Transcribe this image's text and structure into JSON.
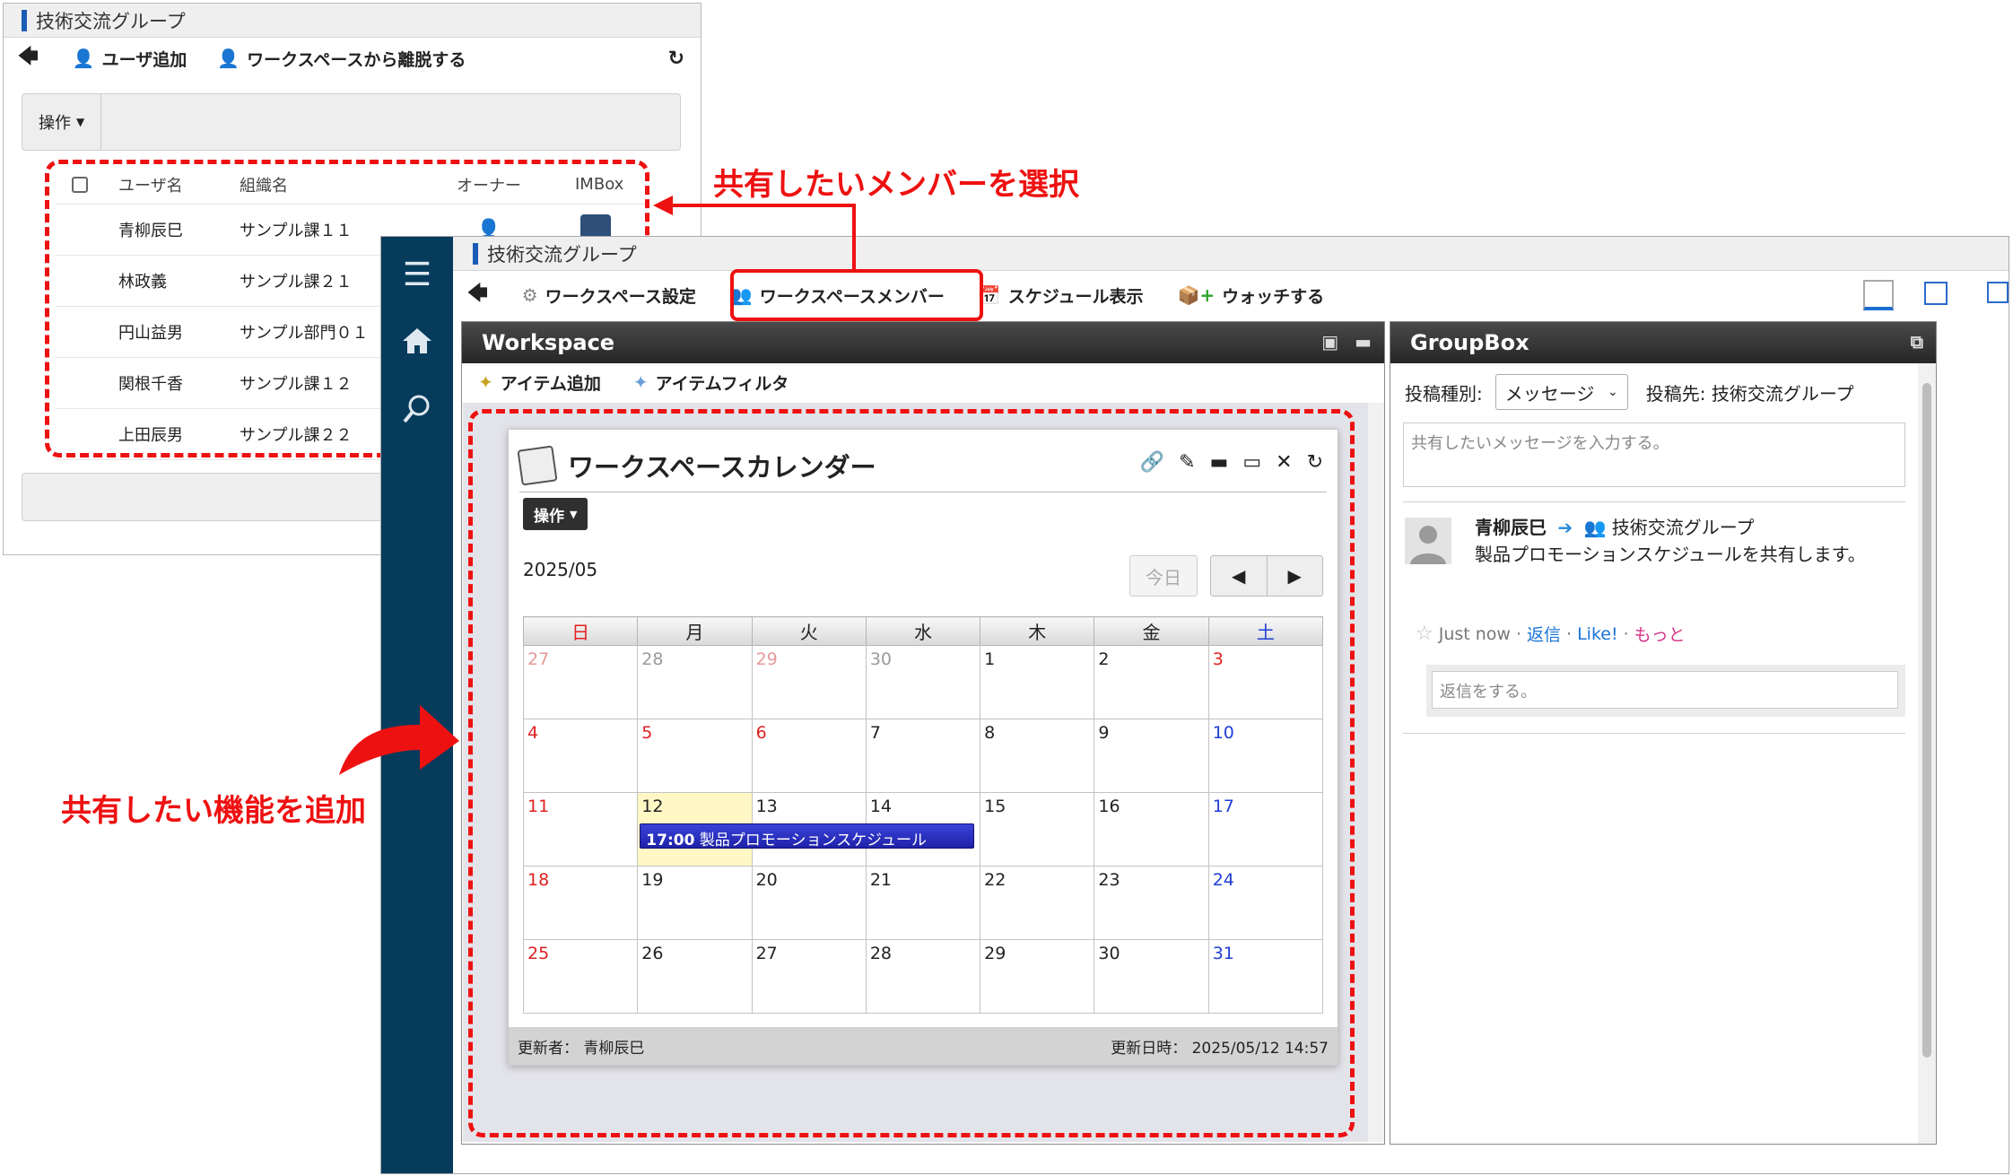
{
  "back_window": {
    "title": "技術交流グループ",
    "toolbar": {
      "add_user": "ユーザ追加",
      "leave": "ワークスペースから離脱する"
    },
    "ops_label": "操作",
    "table": {
      "headers": [
        "ユーザ名",
        "組織名",
        "オーナー",
        "IMBox"
      ],
      "rows": [
        {
          "user": "青柳辰巳",
          "org": "サンプル課１１"
        },
        {
          "user": "林政義",
          "org": "サンプル課２１"
        },
        {
          "user": "円山益男",
          "org": "サンプル部門０１"
        },
        {
          "user": "関根千香",
          "org": "サンプル課１２"
        },
        {
          "user": "上田辰男",
          "org": "サンプル課２２"
        }
      ]
    }
  },
  "front_window": {
    "title": "技術交流グループ",
    "toolbar": {
      "settings": "ワークスペース設定",
      "members": "ワークスペースメンバー",
      "schedule": "スケジュール表示",
      "watch": "ウォッチする"
    },
    "workspace": {
      "title": "Workspace",
      "add_item": "アイテム追加",
      "item_filter": "アイテムフィルタ"
    },
    "calendar": {
      "title": "ワークスペースカレンダー",
      "ops_label": "操作",
      "month": "2025/05",
      "today_label": "今日",
      "weekdays": [
        "日",
        "月",
        "火",
        "水",
        "木",
        "金",
        "土"
      ],
      "weeks": [
        [
          "27",
          "28",
          "29",
          "30",
          "1",
          "2",
          "3"
        ],
        [
          "4",
          "5",
          "6",
          "7",
          "8",
          "9",
          "10"
        ],
        [
          "11",
          "12",
          "13",
          "14",
          "15",
          "16",
          "17"
        ],
        [
          "18",
          "19",
          "20",
          "21",
          "22",
          "23",
          "24"
        ],
        [
          "25",
          "26",
          "27",
          "28",
          "29",
          "30",
          "31"
        ]
      ],
      "event": {
        "time": "17:00",
        "title": "製品プロモーションスケジュール"
      },
      "footer": {
        "updater_label": "更新者：",
        "updater": "青柳辰巳",
        "updated_label": "更新日時：",
        "updated": "2025/05/12 14:57"
      }
    },
    "groupbox": {
      "title": "GroupBox",
      "post_type_label": "投稿種別:",
      "post_type_value": "メッセージ",
      "post_to": "投稿先: 技術交流グループ",
      "message_placeholder": "共有したいメッセージを入力する。",
      "post": {
        "author": "青柳辰巳",
        "target": "技術交流グループ",
        "body": "製品プロモーションスケジュールを共有します。"
      },
      "actions": {
        "time": "Just now",
        "reply": "返信",
        "like": "Like!",
        "more": "もっと"
      },
      "reply_placeholder": "返信をする。"
    }
  },
  "annotations": {
    "select_members": "共有したいメンバーを選択",
    "add_feature": "共有したい機能を追加"
  },
  "colors": {
    "accent_red": "#ee1111",
    "nav_rail": "#073b5c",
    "event_blue": "#2a32c6"
  }
}
